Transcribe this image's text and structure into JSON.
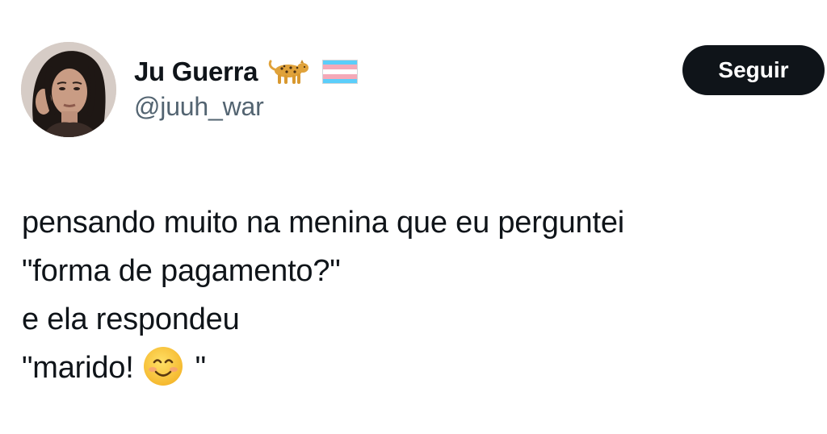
{
  "author": {
    "display_name": "Ju Guerra",
    "handle": "@juuh_war",
    "name_emojis": [
      "leopard-icon",
      "transgender-flag-icon"
    ]
  },
  "actions": {
    "follow_label": "Seguir"
  },
  "tweet": {
    "lines": [
      "pensando muito na menina que eu perguntei",
      "\"forma de pagamento?\"",
      "e ela respondeu"
    ],
    "last_line_prefix": "\"marido!",
    "last_line_emoji": "smiling-face-icon",
    "last_line_suffix": "\""
  },
  "colors": {
    "text": "#0f1419",
    "secondary_text": "#536471",
    "button_bg": "#0f1419",
    "button_text": "#ffffff",
    "flag_blue": "#5bcefa",
    "flag_pink": "#f5a9b8",
    "flag_white": "#ffffff"
  }
}
